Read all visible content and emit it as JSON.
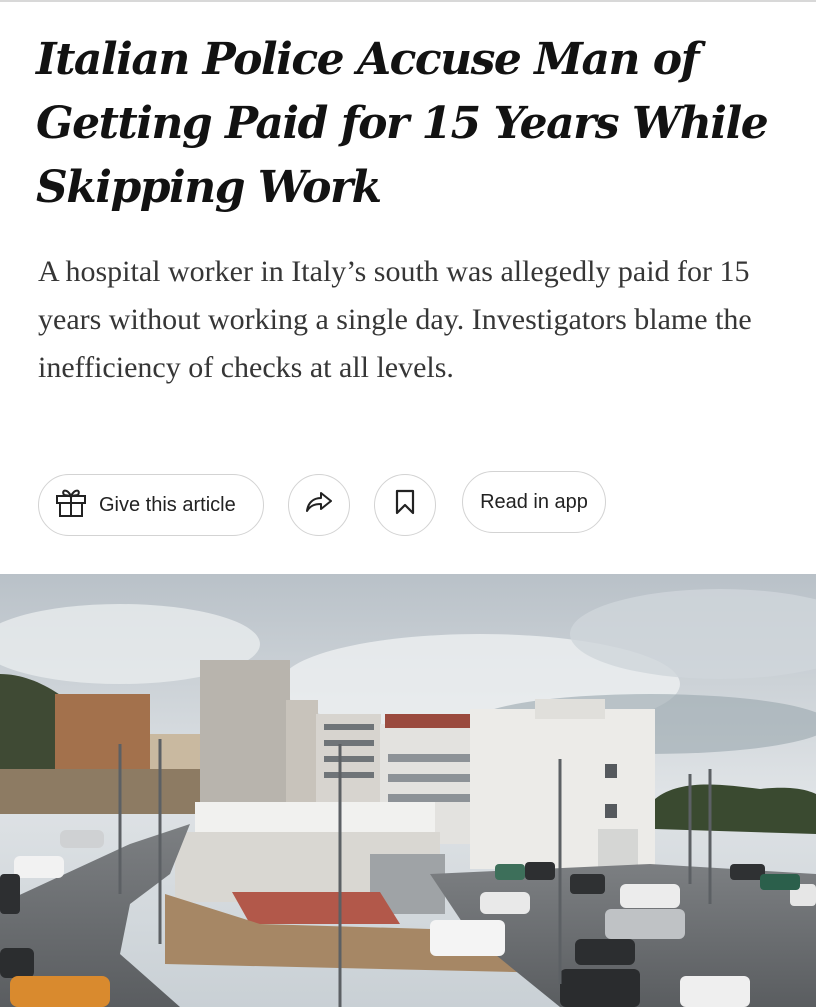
{
  "article": {
    "headline": "Italian Police Accuse Man of Getting Paid for 15 Years While Skipping Work",
    "summary": "A hospital worker in Italy’s south was allegedly paid for 15 years without working a single day. Investigators blame the inefficiency of checks at all levels."
  },
  "actions": {
    "gift_label": "Give this article",
    "gift_icon": "gift-icon",
    "share_icon": "share-arrow-icon",
    "save_icon": "bookmark-icon",
    "read_in_app_label": "Read in app"
  },
  "photo": {
    "subject": "panorama of hospital building and parking lot"
  }
}
